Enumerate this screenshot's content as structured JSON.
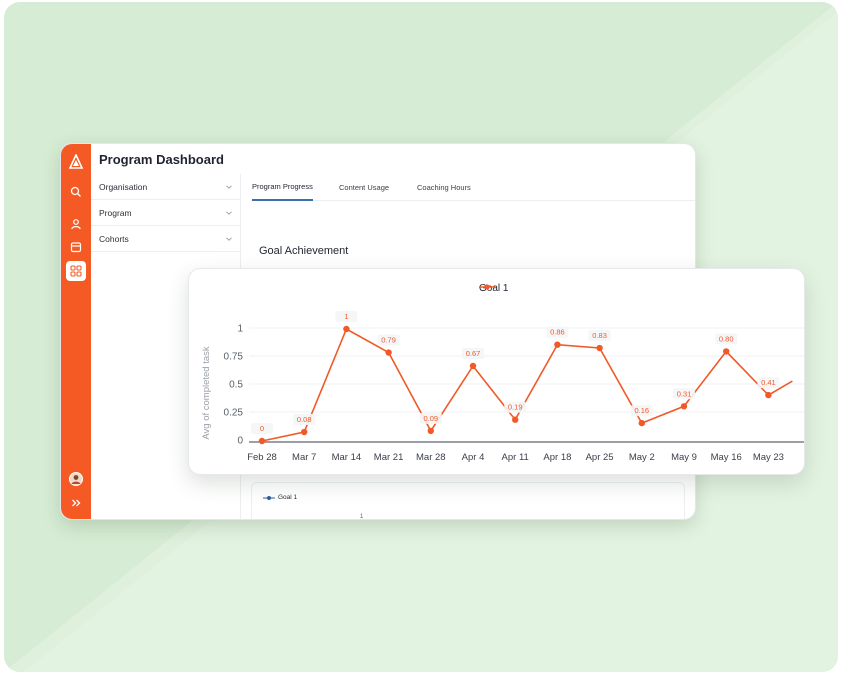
{
  "app": {
    "page_title": "Program Dashboard"
  },
  "sidebar": {
    "icons": [
      "logo-icon",
      "search-icon",
      "user-icon",
      "calendar-icon",
      "dashboard-grid-icon",
      "avatar",
      "expand-chevrons-icon"
    ],
    "accent_color": "#f55a24"
  },
  "filters": {
    "items": [
      {
        "label": "Organisation"
      },
      {
        "label": "Program"
      },
      {
        "label": "Cohorts"
      }
    ]
  },
  "tabs": [
    {
      "label": "Program Progress",
      "active": true
    },
    {
      "label": "Content Usage",
      "active": false
    },
    {
      "label": "Coaching Hours",
      "active": false
    }
  ],
  "section": {
    "title": "Goal Achievement"
  },
  "bottom_chart": {
    "legend": "Goal 1",
    "tick": "1",
    "series_color": "#2b5ea7"
  },
  "chart_data": {
    "type": "line",
    "ylabel": "Avg of completed task",
    "xlabel": "",
    "ylim": [
      0,
      1
    ],
    "yticks": [
      "0",
      "0.25",
      "0.5",
      "0.75",
      "1"
    ],
    "categories": [
      "Feb 28",
      "Mar 7",
      "Mar 14",
      "Mar 21",
      "Mar 28",
      "Apr 4",
      "Apr 11",
      "Apr 18",
      "Apr 25",
      "May 2",
      "May 9",
      "May 16",
      "May 23"
    ],
    "series": [
      {
        "name": "Goal 1",
        "color": "#f05a28",
        "values": [
          0,
          0.08,
          1,
          0.79,
          0.09,
          0.67,
          0.19,
          0.86,
          0.83,
          0.16,
          0.31,
          0.8,
          0.41
        ],
        "labels": [
          "0",
          "0.08",
          "1",
          "0.79",
          "0.09",
          "0.67",
          "0.19",
          "0.86",
          "0.83",
          "0.16",
          "0.31",
          "0.80",
          "0.41"
        ]
      }
    ],
    "grid": true,
    "legend_position": "top-center"
  }
}
